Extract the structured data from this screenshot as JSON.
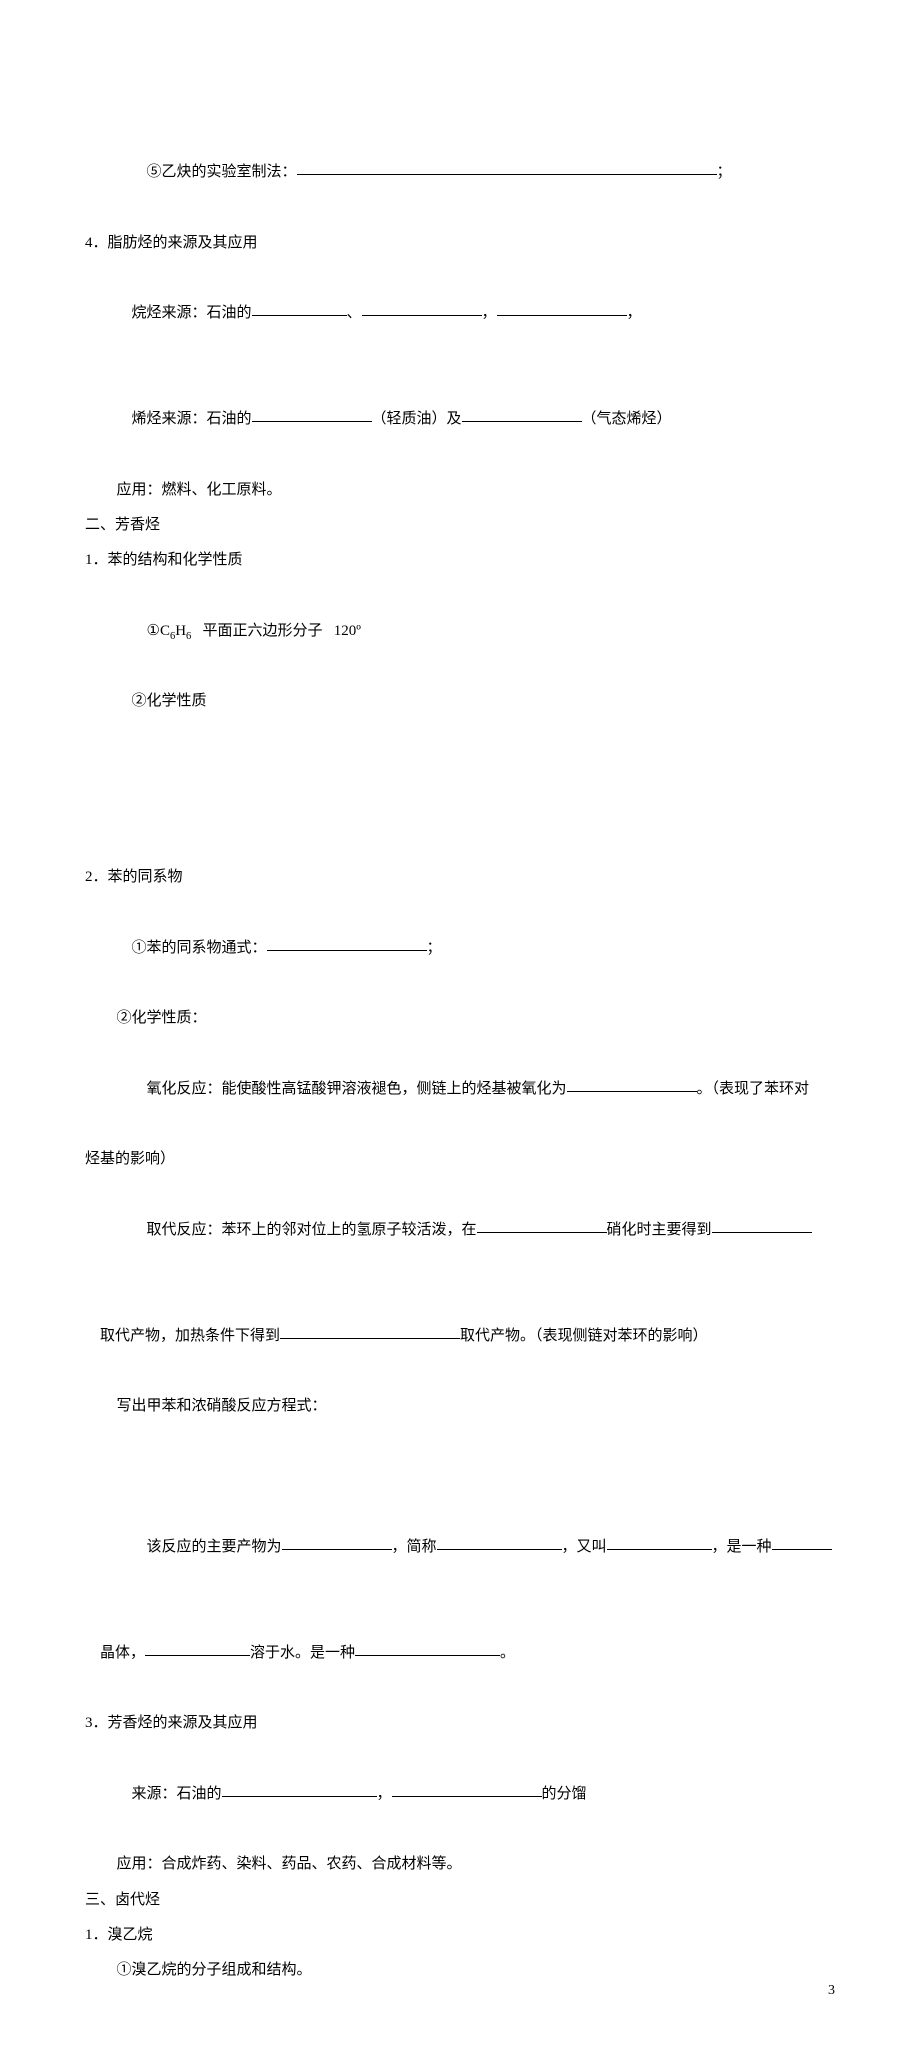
{
  "p5_prefix": "⑤乙炔的实验室制法：",
  "p5_suffix": "；",
  "s4_title": "4．脂肪烃的来源及其应用",
  "s4_a_prefix": "烷烃来源：石油的",
  "s4_a_sep1": "、",
  "s4_a_sep2": "，",
  "s4_a_sep3": "，",
  "s4_b_prefix": "烯烃来源：石油的",
  "s4_b_label1": "（轻质油）及",
  "s4_b_label2": "（气态烯烃）",
  "s4_c": "应用：燃料、化工原料。",
  "h2": "二、芳香烃",
  "b1_title": "1．苯的结构和化学性质",
  "b1_1a": "①C",
  "b1_1b": "H",
  "b1_1c": "   平面正六边形分子   120º",
  "b1_2": "②化学性质",
  "b2_title": "2．苯的同系物",
  "b2_1_prefix": "①苯的同系物通式：",
  "b2_1_suffix": "；",
  "b2_2": "②化学性质：",
  "b2_ox_a": "氧化反应：能使酸性高锰酸钾溶液褪色，侧链上的烃基被氧化为",
  "b2_ox_b": "。（表现了苯环对",
  "b2_ox_c": "烃基的影响）",
  "b2_sub_a": "取代反应：苯环上的邻对位上的氢原子较活泼，在",
  "b2_sub_b": "硝化时主要得到",
  "b2_sub_c": "取代产物，加热条件下得到",
  "b2_sub_d": "取代产物。（表现侧链对苯环的影响）",
  "b2_eq": "写出甲苯和浓硝酸反应方程式：",
  "b2_prod_a": "该反应的主要产物为",
  "b2_prod_b": "，简称",
  "b2_prod_c": "，又叫",
  "b2_prod_d": "，是一种",
  "b2_prod_e": "晶体，",
  "b2_prod_f": "溶于水。是一种",
  "b2_prod_g": "。",
  "b3_title": "3．芳香烃的来源及其应用",
  "b3_src_a": "来源：石油的",
  "b3_src_b": "，",
  "b3_src_c": "的分馏",
  "b3_app": "应用：合成炸药、染料、药品、农药、合成材料等。",
  "h3": "三、卤代烃",
  "c1_title": "1．溴乙烷",
  "c1_1": "①溴乙烷的分子组成和结构。",
  "pagenum": "3"
}
